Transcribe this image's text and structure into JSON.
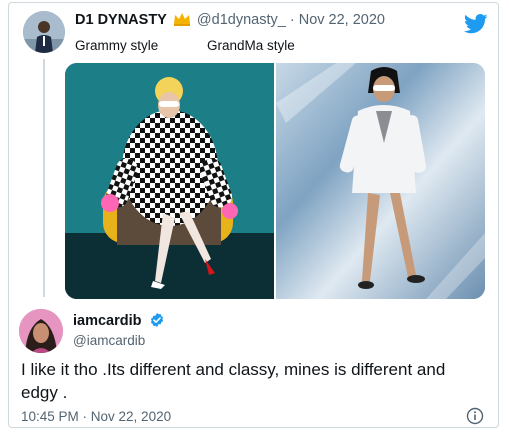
{
  "quoted_tweet": {
    "name": "D1 DYNASTY",
    "handle": "@d1dynasty_",
    "separator": "·",
    "date": "Nov 22, 2020",
    "captions": [
      "Grammy style",
      "GrandMa style"
    ],
    "icons": [
      "crown-icon",
      "twitter-bird-icon"
    ]
  },
  "tweet": {
    "name": "iamcardib",
    "handle": "@iamcardib",
    "text": "I like it tho .Its different and classy, mines is different and edgy .",
    "timestamp": "10:45 PM · Nov 22, 2020",
    "icons": [
      "verified-icon",
      "info-icon"
    ]
  },
  "colors": {
    "twitter_blue": "#1d9bf0",
    "text_secondary": "#536471",
    "border": "#cfd9de"
  }
}
